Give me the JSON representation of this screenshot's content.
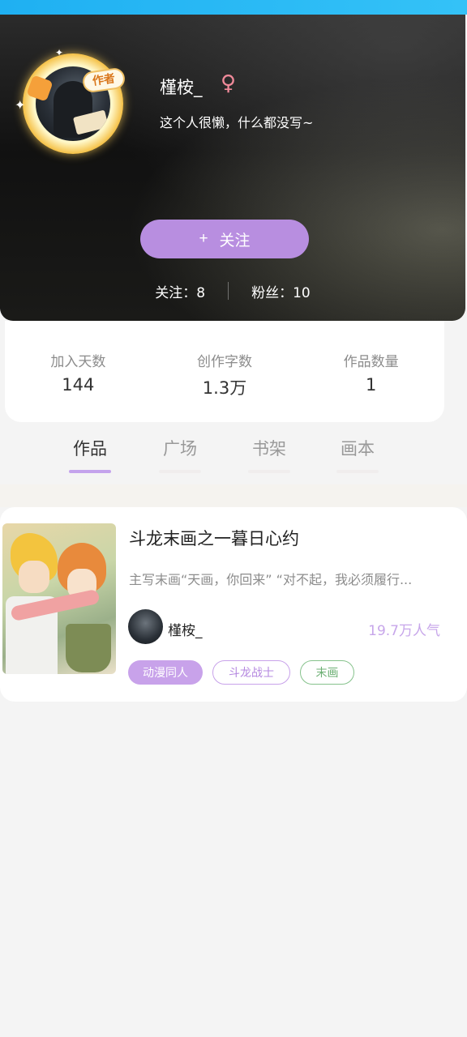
{
  "profile": {
    "username": "槿桉_",
    "gender_symbol": "♀",
    "bio": "这个人很懒，什么都没写~",
    "author_badge": "作者",
    "follow_button": {
      "plus": "+",
      "label": "关注"
    },
    "following_label": "关注：8",
    "followers_label": "粉丝：10"
  },
  "info": [
    {
      "label": "加入天数",
      "value": "144"
    },
    {
      "label": "创作字数",
      "value": "1.3万"
    },
    {
      "label": "作品数量",
      "value": "1"
    }
  ],
  "tabs": [
    {
      "label": "作品",
      "active": true
    },
    {
      "label": "广场",
      "active": false
    },
    {
      "label": "书架",
      "active": false
    },
    {
      "label": "画本",
      "active": false
    }
  ],
  "work": {
    "title": "斗龙末画之一暮日心约",
    "description": "主写末画“天画，你回来” “对不起，我必须履行...",
    "author": "槿桉_",
    "popularity": "19.7万人气",
    "tags": [
      "动漫同人",
      "斗龙战士",
      "末画"
    ]
  },
  "colors": {
    "accent": "#b88ee0",
    "top_bar": "#1fb0f2",
    "tag_green": "#86c28c"
  }
}
